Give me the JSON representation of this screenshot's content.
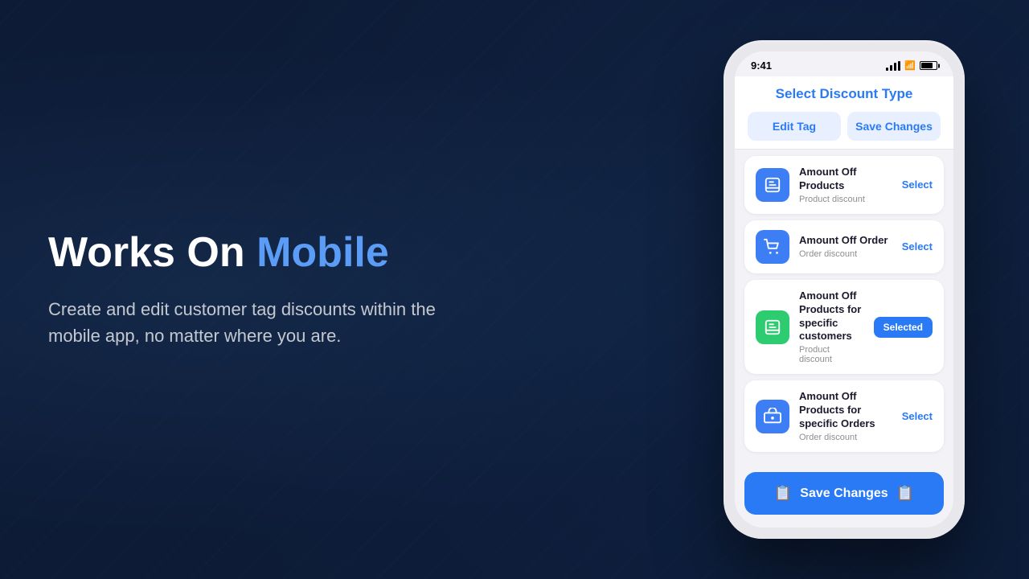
{
  "background": {
    "color": "#0d1b36"
  },
  "left": {
    "heading_plain": "Works On ",
    "heading_highlight": "Mobile",
    "description": "Create and edit customer tag discounts within the mobile app, no matter where you are."
  },
  "phone": {
    "status_bar": {
      "time": "9:41",
      "signal": "●●●",
      "wifi": "WiFi",
      "battery": "Battery"
    },
    "screen": {
      "title": "Select Discount Type",
      "header_buttons": [
        {
          "id": "edit-tag",
          "label": "Edit Tag"
        },
        {
          "id": "save-changes-header",
          "label": "Save Changes"
        }
      ],
      "discount_items": [
        {
          "id": "amount-off-products",
          "icon": "📦",
          "icon_style": "blue",
          "title": "Amount Off Products",
          "subtitle": "Product discount",
          "action": "Select",
          "action_type": "select"
        },
        {
          "id": "amount-off-order",
          "icon": "🛒",
          "icon_style": "blue",
          "title": "Amount Off Order",
          "subtitle": "Order discount",
          "action": "Select",
          "action_type": "select"
        },
        {
          "id": "amount-off-products-specific-customers",
          "icon": "📦",
          "icon_style": "green",
          "title": "Amount Off Products for specific customers",
          "subtitle": "Product discount",
          "action": "Selected",
          "action_type": "selected"
        },
        {
          "id": "amount-off-products-specific-orders",
          "icon": "🚚",
          "icon_style": "blue",
          "title": "Amount Off Products for specific Orders",
          "subtitle": "Order discount",
          "action": "Select",
          "action_type": "select"
        }
      ],
      "save_button": {
        "label": "Save Changes",
        "icon_left": "📋",
        "icon_right": "📋"
      }
    }
  }
}
